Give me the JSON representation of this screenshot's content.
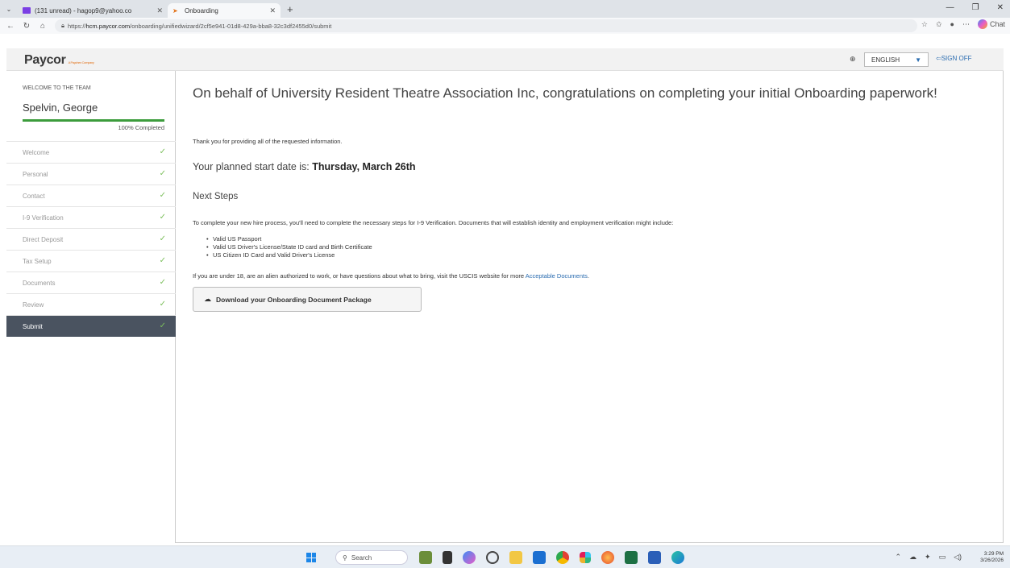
{
  "browser": {
    "tabs": [
      {
        "title": "(131 unread) - hagop9@yahoo.co",
        "active": false
      },
      {
        "title": "Onboarding",
        "active": true
      }
    ],
    "url_prefix": "https://",
    "url_host": "hcm.paycor.com",
    "url_path": "/onboarding/unifiedwizard/2cf5e941-01d8-429a-bba8-32c3df2455d0/submit",
    "chat_label": "Chat"
  },
  "header": {
    "logo_text": "Paycor",
    "logo_tagline": "A Paychex Company",
    "language": "ENGLISH",
    "signoff": "SIGN OFF"
  },
  "sidebar": {
    "welcome": "WELCOME TO THE TEAM",
    "employee_name": "Spelvin, George",
    "progress_fraction": 1.0,
    "progress_label": "100% Completed",
    "steps": [
      {
        "label": "Welcome",
        "done": true,
        "active": false
      },
      {
        "label": "Personal",
        "done": true,
        "active": false
      },
      {
        "label": "Contact",
        "done": true,
        "active": false
      },
      {
        "label": "I-9 Verification",
        "done": true,
        "active": false
      },
      {
        "label": "Direct Deposit",
        "done": true,
        "active": false
      },
      {
        "label": "Tax Setup",
        "done": true,
        "active": false
      },
      {
        "label": "Documents",
        "done": true,
        "active": false
      },
      {
        "label": "Review",
        "done": true,
        "active": false
      },
      {
        "label": "Submit",
        "done": true,
        "active": true
      }
    ]
  },
  "main": {
    "headline": "On behalf of University Resident Theatre Association Inc, congratulations on completing your initial Onboarding paperwork!",
    "thanks": "Thank you for providing all of the requested information.",
    "start_date_prefix": "Your planned start date is: ",
    "start_date": "Thursday, March 26th",
    "next_steps_title": "Next Steps",
    "todo_text": "To complete your new hire process, you'll need to complete the necessary steps for I-9 Verification. Documents that will establish identity and employment verification might include:",
    "documents": [
      "Valid US Passport",
      "Valid US Driver's License/State ID card and Birth Certificate",
      "US Citizen ID Card and Valid Driver's License"
    ],
    "under18_text": "If you are under 18, are an alien authorized to work, or have questions about what to bring, visit the USCIS website for more ",
    "acceptable_docs_link": "Acceptable Documents",
    "under18_suffix": ".",
    "download_button": "Download your Onboarding Document Package"
  },
  "taskbar": {
    "search_placeholder": "Search",
    "time": "3:29 PM",
    "date": "3/26/2026"
  },
  "colors": {
    "progress": "#3c9c3c",
    "active_step_bg": "#4a5360",
    "link": "#2a6cb0",
    "check": "#7cbf5c"
  }
}
